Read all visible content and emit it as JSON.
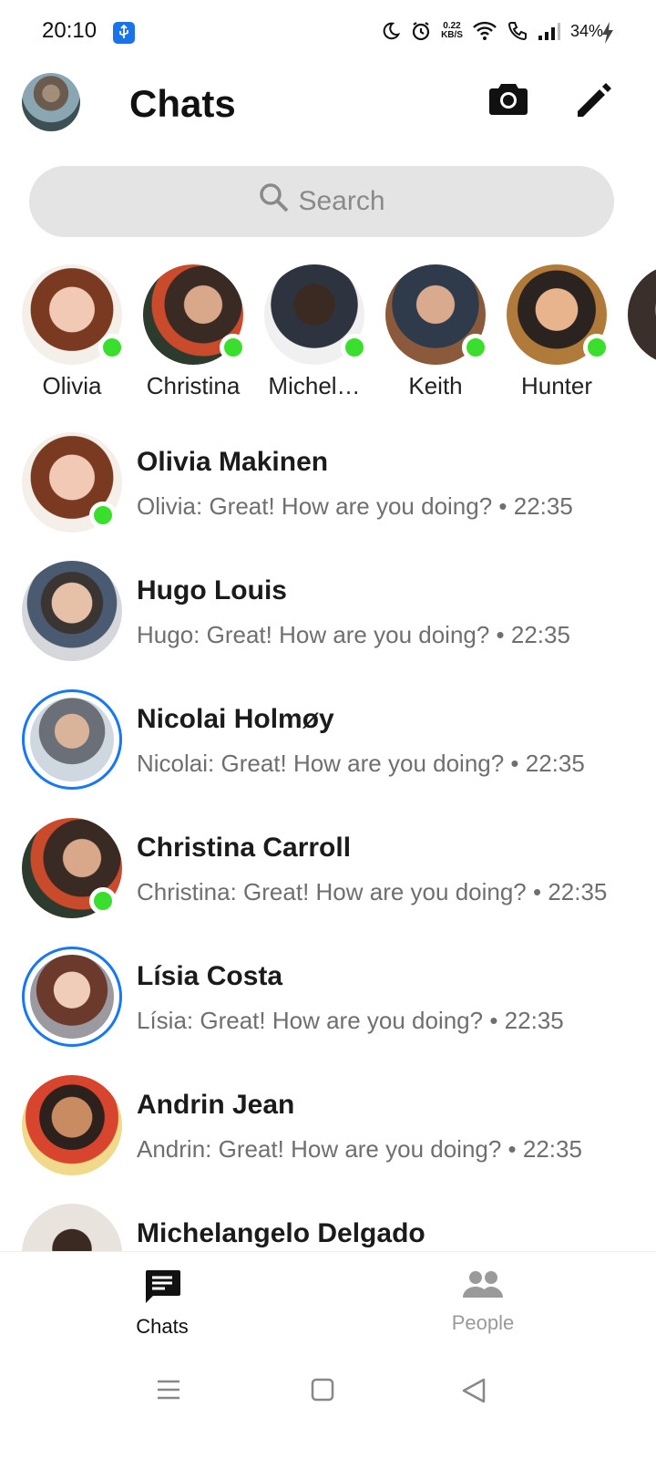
{
  "status_bar": {
    "time": "20:10",
    "speed_value": "0.22",
    "speed_unit": "KB/S",
    "battery": "34%",
    "icons": [
      "usb-icon",
      "moon-icon",
      "alarm-icon",
      "wifi-icon",
      "call-icon",
      "signal-icon",
      "charging-icon"
    ]
  },
  "header": {
    "title": "Chats",
    "camera_icon": "camera-icon",
    "compose_icon": "pencil-icon"
  },
  "search": {
    "placeholder": "Search"
  },
  "stories": [
    {
      "name": "Olivia",
      "online": true
    },
    {
      "name": "Christina",
      "online": true
    },
    {
      "name": "Michel…",
      "online": true
    },
    {
      "name": "Keith",
      "online": true
    },
    {
      "name": "Hunter",
      "online": true
    }
  ],
  "chats": [
    {
      "name": "Olivia Makinen",
      "preview": "Olivia: Great! How are you doing? • 22:35",
      "online": true,
      "story": false
    },
    {
      "name": "Hugo Louis",
      "preview": "Hugo: Great! How are you doing? • 22:35",
      "online": false,
      "story": false
    },
    {
      "name": "Nicolai Holmøy",
      "preview": "Nicolai: Great! How are you doing? • 22:35",
      "online": false,
      "story": true
    },
    {
      "name": "Christina Carroll",
      "preview": "Christina: Great! How are you doing? • 22:35",
      "online": true,
      "story": false
    },
    {
      "name": "Lísia Costa",
      "preview": "Lísia: Great! How are you doing? • 22:35",
      "online": false,
      "story": true
    },
    {
      "name": "Andrin Jean",
      "preview": "Andrin: Great! How are you doing? • 22:35",
      "online": false,
      "story": false
    },
    {
      "name": "Michelangelo Delgado",
      "preview": "",
      "online": false,
      "story": false
    }
  ],
  "tabs": {
    "chats_label": "Chats",
    "people_label": "People"
  },
  "colors": {
    "accent": "#1877f2",
    "online": "#3adf2d",
    "search_bg": "#e4e4e4"
  }
}
